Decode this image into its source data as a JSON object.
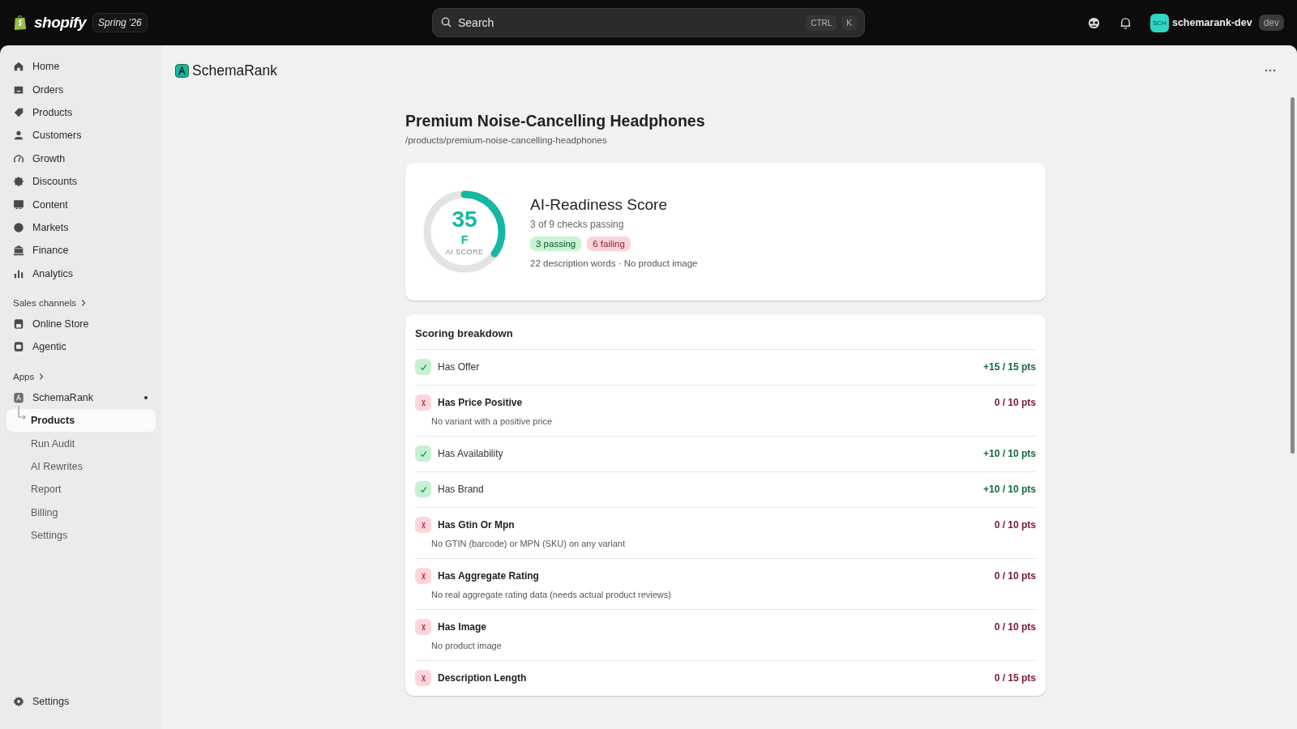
{
  "topbar": {
    "brand": "shopify",
    "edition": "Spring '26",
    "search": {
      "placeholder": "Search",
      "keys": [
        "CTRL",
        "K"
      ]
    },
    "account": {
      "initials": "SCH",
      "name": "schemarank-dev",
      "badge": "dev"
    }
  },
  "sidebar": {
    "items": [
      {
        "label": "Home",
        "selected": false
      },
      {
        "label": "Orders",
        "selected": false
      },
      {
        "label": "Products",
        "selected": false
      },
      {
        "label": "Customers",
        "selected": false
      },
      {
        "label": "Growth",
        "selected": false
      },
      {
        "label": "Discounts",
        "selected": false
      },
      {
        "label": "Content",
        "selected": false
      },
      {
        "label": "Markets",
        "selected": false
      },
      {
        "label": "Finance",
        "selected": false
      },
      {
        "label": "Analytics",
        "selected": false
      }
    ],
    "sales_channels": {
      "heading": "Sales channels",
      "items": [
        {
          "label": "Online Store",
          "selected": false
        },
        {
          "label": "Agentic",
          "selected": false
        }
      ]
    },
    "apps": {
      "heading": "Apps",
      "app": {
        "label": "SchemaRank",
        "expanded": true,
        "children": [
          {
            "label": "Products",
            "selected": true
          },
          {
            "label": "Run Audit",
            "selected": false
          },
          {
            "label": "AI Rewrites",
            "selected": false
          },
          {
            "label": "Report",
            "selected": false
          },
          {
            "label": "Billing",
            "selected": false
          },
          {
            "label": "Settings",
            "selected": false
          }
        ]
      }
    },
    "footer": {
      "label": "Settings"
    }
  },
  "app_header": {
    "title": "SchemaRank"
  },
  "product": {
    "title": "Premium Noise-Cancelling Headphones",
    "path": "/products/premium-noise-cancelling-headphones"
  },
  "score_card": {
    "score": "35",
    "grade": "F",
    "caption": "AI SCORE",
    "level": 0.35,
    "title": "AI-Readiness Score",
    "subtitle": "3 of 9 checks passing",
    "badges": [
      {
        "label": "3 passing",
        "kind": "success"
      },
      {
        "label": "6 failing",
        "kind": "critical"
      }
    ],
    "note": "22 description words · No product image"
  },
  "breakdown": {
    "title": "Scoring breakdown",
    "rows": [
      {
        "name": "Has Offer",
        "passed": true,
        "points": "+15 / 15 pts"
      },
      {
        "name": "Has Price Positive",
        "passed": false,
        "points": "0 / 10 pts",
        "detail": "No variant with a positive price"
      },
      {
        "name": "Has Availability",
        "passed": true,
        "points": "+10 / 10 pts"
      },
      {
        "name": "Has Brand",
        "passed": true,
        "points": "+10 / 10 pts"
      },
      {
        "name": "Has Gtin Or Mpn",
        "passed": false,
        "points": "0 / 10 pts",
        "detail": "No GTIN (barcode) or MPN (SKU) on any variant"
      },
      {
        "name": "Has Aggregate Rating",
        "passed": false,
        "points": "0 / 10 pts",
        "detail": "No real aggregate rating data (needs actual product reviews)"
      },
      {
        "name": "Has Image",
        "passed": false,
        "points": "0 / 10 pts",
        "detail": "No product image"
      },
      {
        "name": "Description Length",
        "passed": false,
        "points": "0 / 15 pts"
      }
    ]
  }
}
